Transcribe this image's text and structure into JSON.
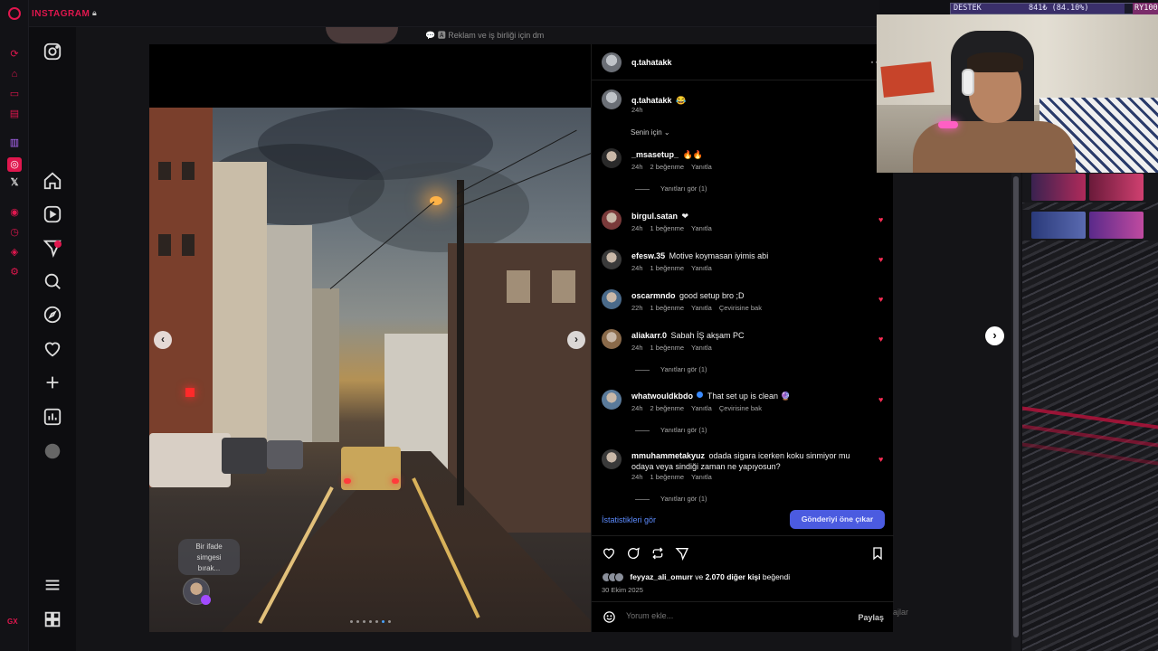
{
  "app": {
    "title": "INSTAGRAM"
  },
  "caption_top": "💬 🅰 Reklam ve iş birliği için dm",
  "donation": {
    "label": "DESTEK",
    "value": "841₺ (84.10%)",
    "progress": 0.841,
    "tail": "RY100"
  },
  "gx_footer": "GX",
  "post": {
    "author": "q.tahatakk",
    "caption_author": "q.tahatakk",
    "caption_emoji": "😂",
    "caption_time": "24h",
    "filter_label": "Senin için",
    "emoji_prompt": [
      "Bir ifade",
      "simgesi",
      "bırak..."
    ]
  },
  "comments": [
    {
      "user": "_msasetup_",
      "text": "🔥🔥",
      "time": "24h",
      "likes": "2 beğenme",
      "reply": "Yanıtla",
      "replies": "Yanıtları gör (1)",
      "liked": false
    },
    {
      "user": "birgul.satan",
      "text": "❤",
      "time": "24h",
      "likes": "1 beğenme",
      "reply": "Yanıtla",
      "liked": true
    },
    {
      "user": "efesw.35",
      "text": "Motive koymasan iyimis abi",
      "time": "24h",
      "likes": "1 beğenme",
      "reply": "Yanıtla",
      "liked": true
    },
    {
      "user": "oscarmndo",
      "text": "good setup bro ;D",
      "time": "22h",
      "likes": "1 beğenme",
      "reply": "Yanıtla",
      "translate": "Çevirisine bak",
      "liked": true
    },
    {
      "user": "aliakarr.0",
      "text": "Sabah İŞ akşam PC",
      "time": "24h",
      "likes": "1 beğenme",
      "reply": "Yanıtla",
      "replies": "Yanıtları gör (1)",
      "liked": true
    },
    {
      "user": "whatwouldkbdo",
      "text": "That set up is clean 🔮",
      "time": "24h",
      "likes": "2 beğenme",
      "reply": "Yanıtla",
      "translate": "Çevirisine bak",
      "replies": "Yanıtları gör (1)",
      "liked": true,
      "verified": true
    },
    {
      "user": "mmuhammetakyuz",
      "text": "odada sigara icerken koku sinmiyor mu",
      "text2": "odaya veya sindiği zaman ne yapıyosun?",
      "time": "24h",
      "likes": "1 beğenme",
      "reply": "Yanıtla",
      "replies": "Yanıtları gör (1)",
      "liked": true
    }
  ],
  "stats_link": "İstatistikleri gör",
  "promote_button": "Gönderiyi öne çıkar",
  "likes_summary": {
    "user": "feyyaz_ali_omurr",
    "connector": "ve",
    "count": "2.070 diğer kişi",
    "suffix": "beğendi"
  },
  "post_date": "30 Ekim 2025",
  "comment_input": {
    "placeholder": "Yorum ekle..."
  },
  "share_label": "Paylaş",
  "side_label": "ajlar",
  "colors": {
    "accent": "#e0174e",
    "link": "#5d8cff",
    "promote": "#4b5be0",
    "heart": "#ff2d55"
  }
}
